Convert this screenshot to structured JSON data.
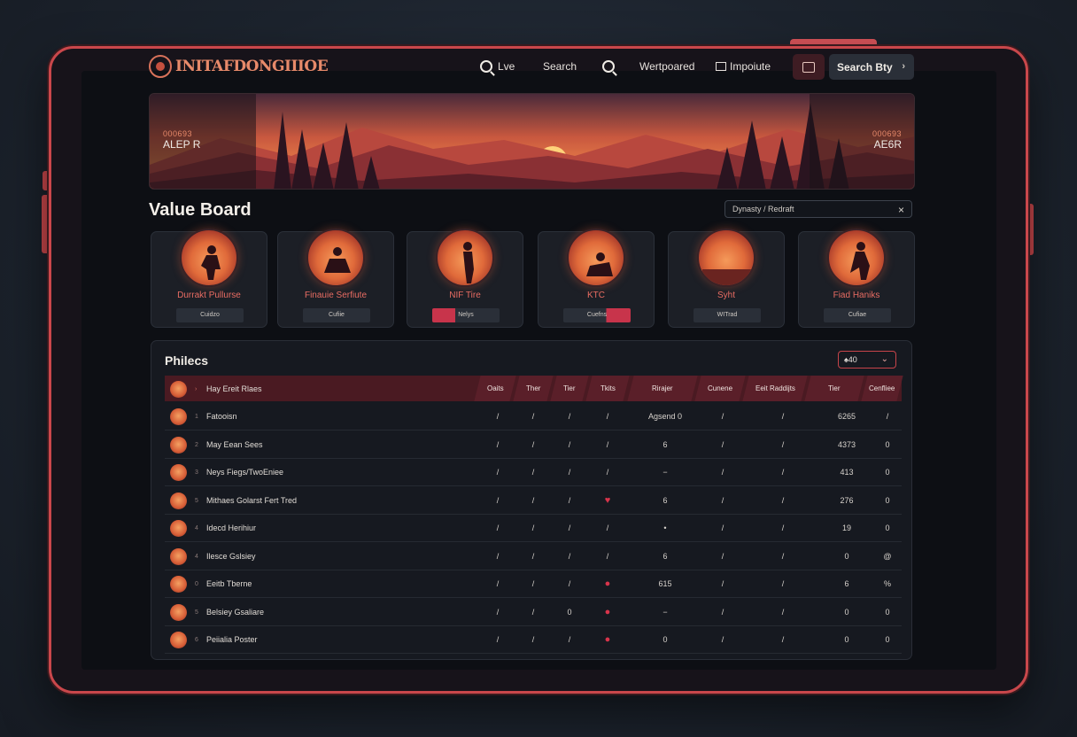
{
  "header": {
    "logo_text": "INITAFDONGIIIOE",
    "nav": [
      {
        "label": "Lve",
        "icon": "search-icon"
      },
      {
        "label": "Search"
      },
      {
        "label": "",
        "icon": "search-icon"
      },
      {
        "label": "Wertpoared"
      },
      {
        "label": "Impoiute",
        "icon": "template-icon"
      }
    ],
    "search_button": "Search Bty"
  },
  "hero": {
    "left_number": "000693",
    "left_code": "ALEP R",
    "right_number": "000693",
    "right_code": "AE6R"
  },
  "value_board": {
    "title": "Value Board",
    "filter_text": "Dynasty / Redraft",
    "cards": [
      {
        "name": "Durrakt Pullurse",
        "tag": "Cuidzo"
      },
      {
        "name": "Finauie Serfiute",
        "tag": "Cufiie"
      },
      {
        "name": "NIF Tire",
        "tag": "Nelys"
      },
      {
        "name": "KTC",
        "tag": "Cuefns"
      },
      {
        "name": "Syht",
        "tag": "WITrad"
      },
      {
        "name": "Fiad Haniks",
        "tag": "Cufiae"
      }
    ]
  },
  "table": {
    "title": "Philecs",
    "select_value": "♠40",
    "columns": [
      "Oaits",
      "Ther",
      "Tier",
      "Tkits",
      "Rirajer",
      "Cunene",
      "Eeit Raddijts",
      "Tier",
      "Cenfliee"
    ],
    "header_player": "Hay Ereit Rlaes",
    "rows": [
      {
        "rank": "1",
        "name": "Fatooisn",
        "c": [
          "/",
          "/",
          "/",
          "/",
          "Agsend 0",
          "/",
          "/",
          "6265",
          "/"
        ]
      },
      {
        "rank": "2",
        "name": "May Eean Sees",
        "c": [
          "/",
          "/",
          "/",
          "/",
          "6",
          "/",
          "/",
          "4373",
          "0"
        ]
      },
      {
        "rank": "3",
        "name": "Neys Fiegs/TwoEniee",
        "c": [
          "/",
          "/",
          "/",
          "/",
          "−",
          "/",
          "/",
          "413",
          "0"
        ]
      },
      {
        "rank": "5",
        "name": "Mithaes Golarst Fert Tred",
        "c": [
          "/",
          "/",
          "/",
          "♥",
          "6",
          "/",
          "/",
          "276",
          "0"
        ]
      },
      {
        "rank": "4",
        "name": "Idecd Herihiur",
        "c": [
          "/",
          "/",
          "/",
          "/",
          "•",
          "/",
          "/",
          "19",
          "0"
        ]
      },
      {
        "rank": "4",
        "name": "Ilesce Gslsiey",
        "c": [
          "/",
          "/",
          "/",
          "/",
          "6",
          "/",
          "/",
          "0",
          "@"
        ]
      },
      {
        "rank": "0",
        "name": "Eeitb Tberne",
        "c": [
          "/",
          "/",
          "/",
          "●",
          "615",
          "/",
          "/",
          "6",
          "%"
        ]
      },
      {
        "rank": "5",
        "name": "Belsiey Gsaliare",
        "c": [
          "/",
          "/",
          "0",
          "●",
          "−",
          "/",
          "/",
          "0",
          "0"
        ]
      },
      {
        "rank": "6",
        "name": "Peiialia Poster",
        "c": [
          "/",
          "/",
          "/",
          "●",
          "0",
          "/",
          "/",
          "0",
          "0"
        ]
      }
    ]
  }
}
